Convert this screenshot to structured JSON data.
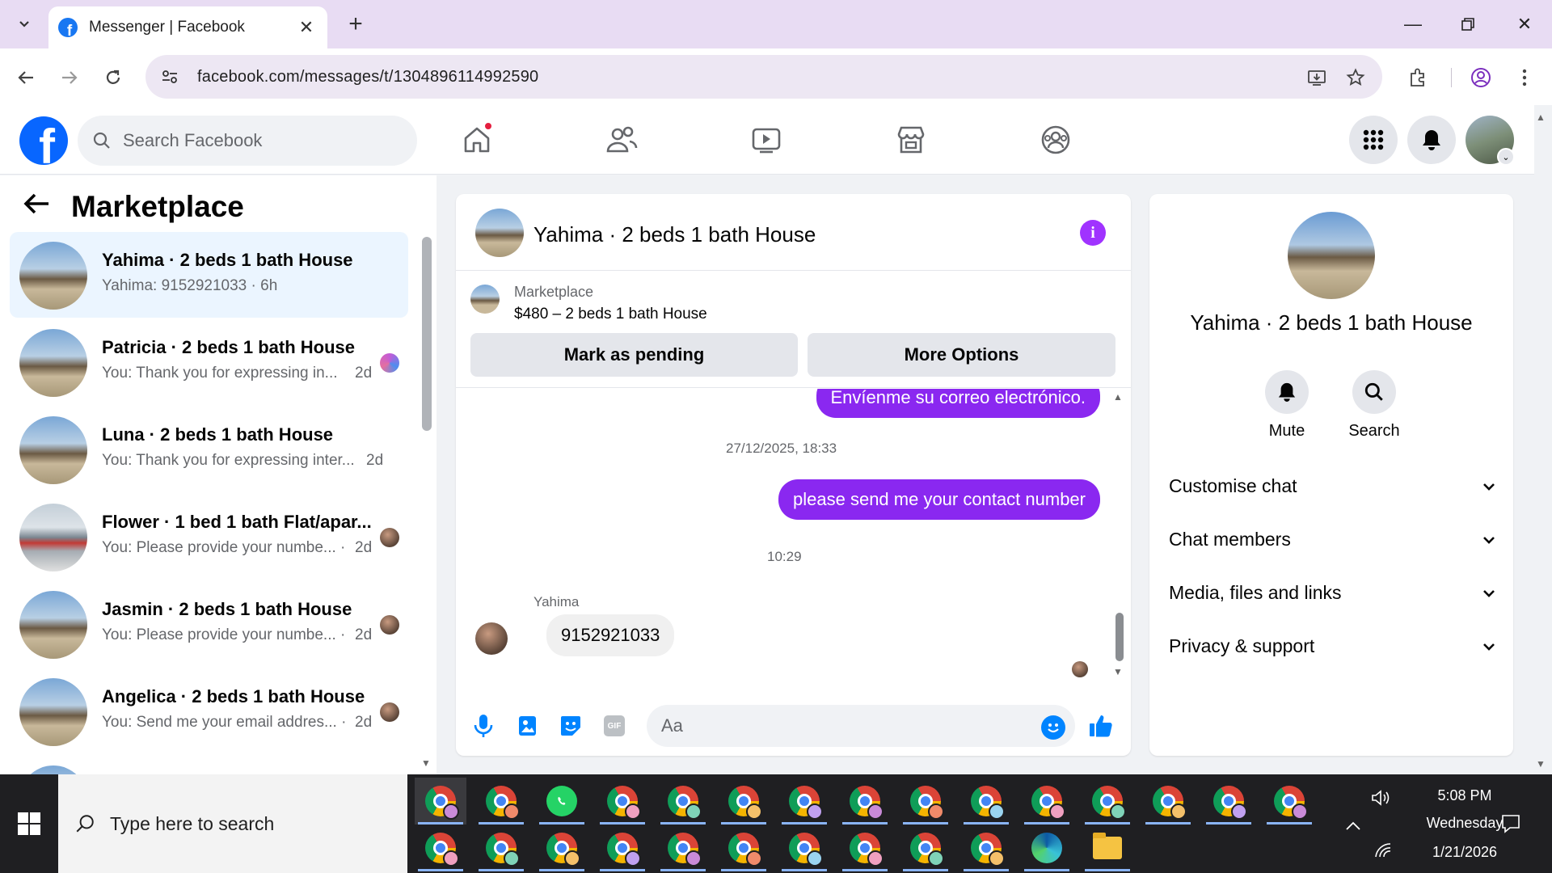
{
  "browser": {
    "tab_title": "Messenger | Facebook",
    "url": "facebook.com/messages/t/1304896114992590"
  },
  "facebook": {
    "search_placeholder": "Search Facebook",
    "logo_letter": "f"
  },
  "list": {
    "title": "Marketplace",
    "conversations": [
      {
        "title": "Yahima · 2 beds 1 bath House",
        "subtitle": "Yahima: 9152921033 · 6h",
        "time": "",
        "active": true,
        "image": "house"
      },
      {
        "title": "Patricia · 2 beds 1 bath House",
        "subtitle": "You: Thank you for expressing in...",
        "time": "2d",
        "image": "house"
      },
      {
        "title": "Luna · 2 beds 1 bath House",
        "subtitle": "You: Thank you for expressing inter...",
        "time": "2d",
        "image": "house"
      },
      {
        "title": "Flower · 1 bed 1 bath Flat/apar...",
        "subtitle": "You: Please provide your numbe... ·",
        "time": "2d",
        "image": "flat"
      },
      {
        "title": "Jasmin · 2 beds 1 bath House",
        "subtitle": "You: Please provide your numbe... ·",
        "time": "2d",
        "image": "house"
      },
      {
        "title": "Angelica · 2 beds 1 bath House",
        "subtitle": "You: Send me your email addres... ·",
        "time": "2d",
        "image": "house"
      }
    ]
  },
  "chat": {
    "name": "Yahima · 2 beds 1 bath House",
    "marketplace_label": "Marketplace",
    "listing": "$480 – 2 beds 1 bath House",
    "mark_pending": "Mark as pending",
    "more_options": "More Options",
    "messages": {
      "partial_out": "Envíenme su correo electrónico.",
      "time1": "27/12/2025, 18:33",
      "out1": "please send me your contact number",
      "time2": "10:29",
      "sender": "Yahima",
      "in1": "9152921033"
    },
    "composer_placeholder": "Aa",
    "gif_label": "GIF"
  },
  "info_panel": {
    "name": "Yahima · 2 beds 1 bath House",
    "mute_label": "Mute",
    "search_label": "Search",
    "sections": [
      "Customise chat",
      "Chat members",
      "Media, files and links",
      "Privacy & support"
    ]
  },
  "taskbar": {
    "search_placeholder": "Type here to search",
    "time": "5:08 PM",
    "day": "Wednesday",
    "date": "1/21/2026"
  },
  "colors": {
    "facebook_blue": "#0866ff",
    "messenger_purple": "#8a28f0",
    "active_row": "#ebf5ff"
  }
}
